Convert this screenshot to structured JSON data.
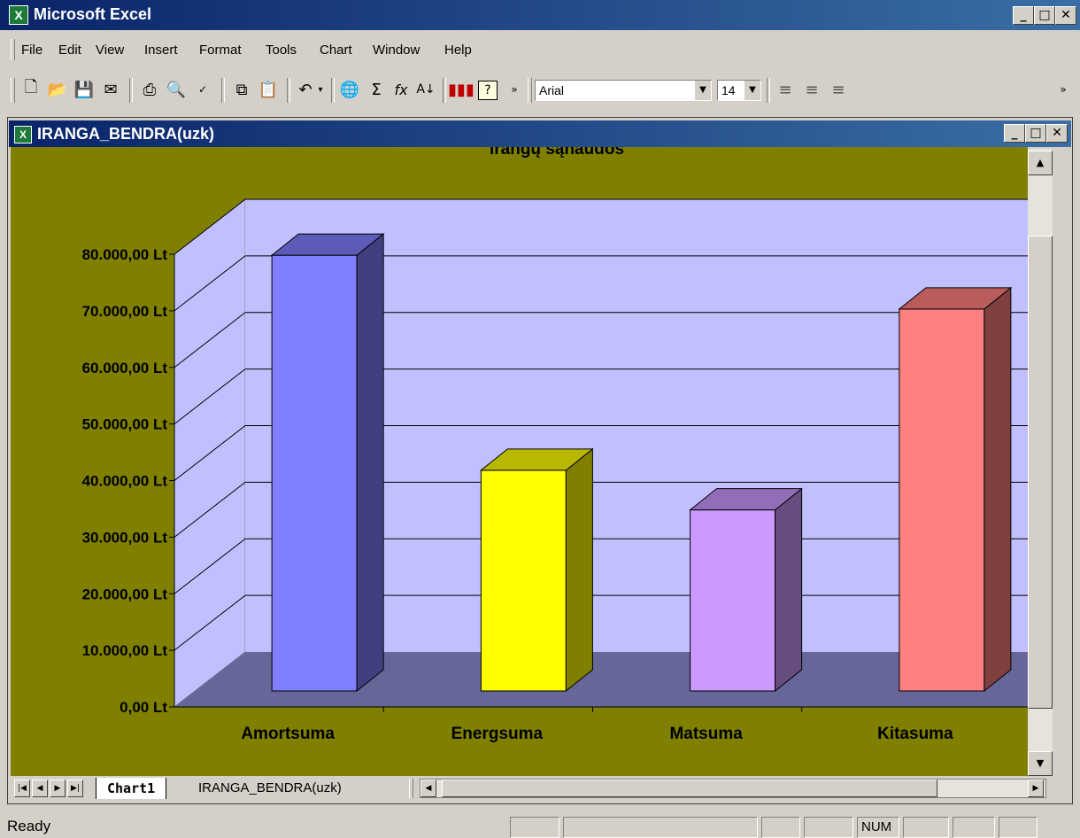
{
  "app": {
    "title": "Microsoft Excel",
    "icon": "excel-icon"
  },
  "menu": {
    "items": [
      "File",
      "Edit",
      "View",
      "Insert",
      "Format",
      "Tools",
      "Chart",
      "Window",
      "Help"
    ]
  },
  "toolbar": {
    "font_name": "Arial",
    "font_size": "14"
  },
  "document": {
    "title": "IRANGA_BENDRA(uzk)"
  },
  "sheet_tabs": {
    "active": "Chart1",
    "other": "IRANGA_BENDRA(uzk)"
  },
  "status": {
    "text": "Ready",
    "num": "NUM"
  },
  "chart_data": {
    "type": "bar",
    "title": "Irangų sąnaudos",
    "categories": [
      "Amortsuma",
      "Energsuma",
      "Matsuma",
      "Kitasuma"
    ],
    "values": [
      77000,
      39000,
      32000,
      67500
    ],
    "colors": [
      "#8080ff",
      "#ffff00",
      "#cc99ff",
      "#ff8080"
    ],
    "ylim": [
      0,
      80000
    ],
    "yticks": [
      "0,00 Lt",
      "10.000,00 Lt",
      "20.000,00 Lt",
      "30.000,00 Lt",
      "40.000,00 Lt",
      "50.000,00 Lt",
      "60.000,00 Lt",
      "70.000,00 Lt",
      "80.000,00 Lt"
    ],
    "grid": true,
    "chart_background": "#808000",
    "wall_color": "#c0c0ff",
    "floor_color": "#666699"
  }
}
